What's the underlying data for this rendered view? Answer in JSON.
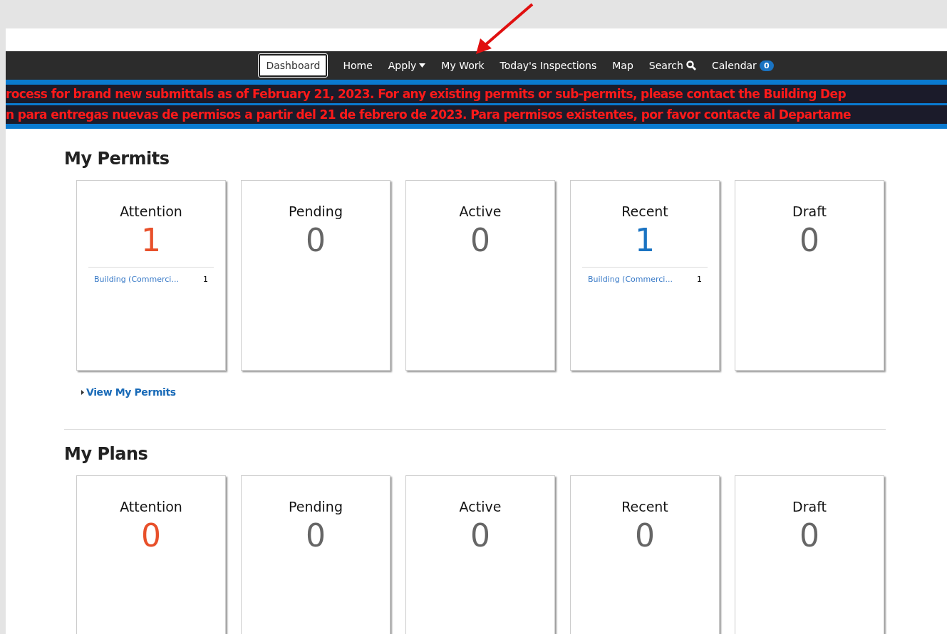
{
  "nav": [
    {
      "label": "Dashboard",
      "selected": true
    },
    {
      "label": "Home",
      "selected": false
    },
    {
      "label": "Apply",
      "selected": false,
      "kind": "dropdown"
    },
    {
      "label": "My Work",
      "selected": false
    },
    {
      "label": "Today's Inspections",
      "selected": false
    },
    {
      "label": "Map",
      "selected": false
    },
    {
      "label": "Search",
      "selected": false,
      "kind": "search"
    },
    {
      "label": "Calendar",
      "selected": false,
      "kind": "badge",
      "badge": "0"
    }
  ],
  "banner": [
    "rocess for brand new submittals as of February 21, 2023. For any existing permits or sub-permits, please contact the Building Dep",
    "n para entregas nuevas de permisos a partir del 21 de febrero de 2023. Para permisos existentes, por favor contacte al Departame"
  ],
  "sections": [
    {
      "title": "My Permits",
      "link": "View My Permits",
      "cards": [
        {
          "title": "Attention",
          "count": "1",
          "color": "#e8502a",
          "rows": [
            {
              "label": "Building (Commerci...",
              "count": "1"
            }
          ]
        },
        {
          "title": "Pending",
          "count": "0",
          "color": "#666666"
        },
        {
          "title": "Active",
          "count": "0",
          "color": "#666666"
        },
        {
          "title": "Recent",
          "count": "1",
          "color": "#1a73c2",
          "rows": [
            {
              "label": "Building (Commerci...",
              "count": "1"
            }
          ]
        },
        {
          "title": "Draft",
          "count": "0",
          "color": "#666666"
        }
      ]
    },
    {
      "title": "My Plans",
      "cards": [
        {
          "title": "Attention",
          "count": "0",
          "color": "#e8502a"
        },
        {
          "title": "Pending",
          "count": "0",
          "color": "#666666"
        },
        {
          "title": "Active",
          "count": "0",
          "color": "#666666"
        },
        {
          "title": "Recent",
          "count": "0",
          "color": "#666666"
        },
        {
          "title": "Draft",
          "count": "0",
          "color": "#666666"
        }
      ]
    }
  ]
}
